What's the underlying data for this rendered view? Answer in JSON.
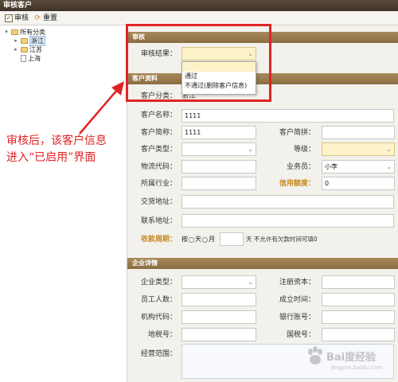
{
  "window": {
    "title": "审核客户"
  },
  "toolbar": {
    "audit_label": "审核",
    "reset_label": "重置"
  },
  "tree": {
    "root": "所有分类",
    "children": [
      "浙江",
      "江苏",
      "上海"
    ]
  },
  "audit_section": {
    "title": "审核",
    "result_label": "审核结果：",
    "options": [
      "",
      "通过",
      "不通过(删除客户信息)"
    ]
  },
  "customer_section": {
    "title": "客户资料",
    "category_label": "客户分类：",
    "category_value": "浙江",
    "name_label": "客户名称：",
    "name_value": "1111",
    "short_label": "客户简称：",
    "short_value": "1111",
    "pinyin_label": "客户简拼：",
    "pinyin_value": "",
    "type_label": "客户类型：",
    "level_label": "等级：",
    "logistics_label": "物流代码：",
    "salesman_label": "业务员：",
    "salesman_value": "小李",
    "industry_label": "所属行业：",
    "credit_label": "信用额度：",
    "credit_value": "0",
    "delivery_label": "交货地址：",
    "contact_label": "联系地址：",
    "period_label": "收款周期：",
    "period_by": "按",
    "period_day": "天",
    "period_month": "月",
    "period_suffix": "天 不允许有欠款时间可填0"
  },
  "enterprise_section": {
    "title": "企业详情",
    "etype_label": "企业类型：",
    "capital_label": "注册资本：",
    "staff_label": "员工人数：",
    "founded_label": "成立时间：",
    "org_label": "机构代码：",
    "bank_label": "银行账号：",
    "localtax_label": "地税号：",
    "nationaltax_label": "国税号：",
    "scope_label": "经营范围："
  },
  "annotation": {
    "line1": "审核后，该客户信息",
    "line2": "进入“已启用”界面"
  },
  "watermark": {
    "text": "Bai度经验",
    "url": "jingyan.baidu.com"
  },
  "colors": {
    "section_bar": "#8a6c42",
    "annotation": "#e02424",
    "highlight_label": "#c58a22"
  }
}
